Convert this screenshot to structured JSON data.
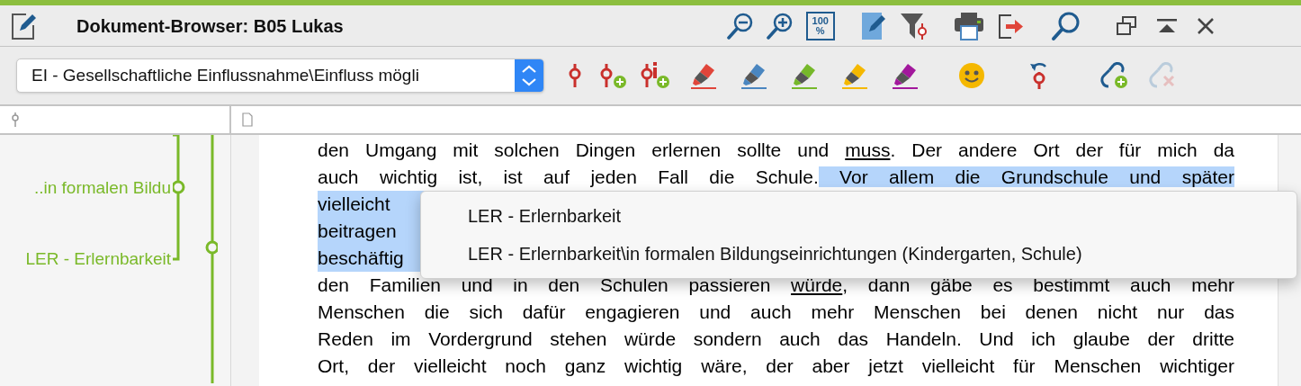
{
  "window": {
    "title": "Dokument-Browser: B05 Lukas"
  },
  "title_tools": [
    {
      "kind": "zoom-out"
    },
    {
      "kind": "zoom-in"
    },
    {
      "kind": "zoom-100",
      "label": "100",
      "unit": "%"
    },
    {
      "kind": "edit",
      "selected": true
    },
    {
      "kind": "filter"
    },
    {
      "kind": "print"
    },
    {
      "kind": "export"
    },
    {
      "kind": "search"
    }
  ],
  "window_controls": [
    {
      "kind": "restore"
    },
    {
      "kind": "collapse"
    },
    {
      "kind": "close"
    }
  ],
  "code_selector": {
    "value": "EI - Gesellschaftliche Einflussnahme\\Einfluss mögli"
  },
  "toolbar": [
    {
      "kind": "code",
      "disabled": false
    },
    {
      "kind": "code-add",
      "disabled": false
    },
    {
      "kind": "codes-add",
      "disabled": false
    },
    {
      "kind": "highlight",
      "color": "#e0453a",
      "disabled": false
    },
    {
      "kind": "highlight",
      "color": "#4a86c0",
      "disabled": false
    },
    {
      "kind": "highlight",
      "color": "#76b82a",
      "disabled": false
    },
    {
      "kind": "highlight",
      "color": "#f5b800",
      "disabled": false
    },
    {
      "kind": "highlight",
      "color": "#a2189c",
      "disabled": false
    },
    {
      "kind": "emoticon",
      "disabled": false
    },
    {
      "kind": "undo-code",
      "disabled": false
    },
    {
      "kind": "link-add",
      "disabled": false
    },
    {
      "kind": "link-remove",
      "disabled": true
    }
  ],
  "code_stripes": [
    {
      "label": "..in formalen Bildu"
    },
    {
      "label": "LER - Erlernbarkeit"
    }
  ],
  "document_lines": [
    {
      "highlighted": false,
      "segments": [
        {
          "text": "den Umgang mit solchen Dingen erlernen sollte und ",
          "underlined": false,
          "highlighted": false
        },
        {
          "text": "muss",
          "underlined": true,
          "highlighted": false
        },
        {
          "text": ". Der andere Ort der für mich da",
          "underlined": false,
          "highlighted": false
        }
      ]
    },
    {
      "highlighted": false,
      "segments": [
        {
          "text": "auch wichtig ist, ist auf jeden Fall die Schule.",
          "underlined": false,
          "highlighted": false
        },
        {
          "text": " Vor allem die Grundschule und später",
          "underlined": false,
          "highlighted": true
        }
      ]
    },
    {
      "highlighted": true,
      "segments": [
        {
          "text": "vielleicht",
          "underlined": false
        }
      ]
    },
    {
      "highlighted": true,
      "segments": [
        {
          "text": "beitragen",
          "underlined": false
        }
      ]
    },
    {
      "highlighted": true,
      "segments": [
        {
          "text": "beschäftig",
          "underlined": false
        }
      ]
    },
    {
      "highlighted": false,
      "segments": [
        {
          "text": "den Familien und in den Schulen passieren ",
          "underlined": false,
          "highlighted": false
        },
        {
          "text": "würde",
          "underlined": true,
          "highlighted": false
        },
        {
          "text": ", dann gäbe es bestimmt auch mehr",
          "underlined": false,
          "highlighted": false
        }
      ]
    },
    {
      "highlighted": false,
      "segments": [
        {
          "text": "Menschen die sich dafür engagieren und auch mehr Menschen bei denen nicht nur das",
          "underlined": false,
          "highlighted": false
        }
      ]
    },
    {
      "highlighted": false,
      "segments": [
        {
          "text": "Reden im Vordergrund stehen würde sondern auch das Handeln. Und ich glaube der dritte",
          "underlined": false,
          "highlighted": false
        }
      ]
    },
    {
      "highlighted": false,
      "segments": [
        {
          "text": "Ort, der vielleicht noch ganz wichtig wäre, der aber jetzt vielleicht für Menschen wichtiger",
          "underlined": false,
          "highlighted": false
        }
      ]
    }
  ],
  "context_menu": {
    "items": [
      {
        "label": "LER - Erlernbarkeit"
      },
      {
        "label": "LER - Erlernbarkeit\\in formalen Bildungseinrichtungen (Kindergarten, Schule)"
      }
    ]
  }
}
